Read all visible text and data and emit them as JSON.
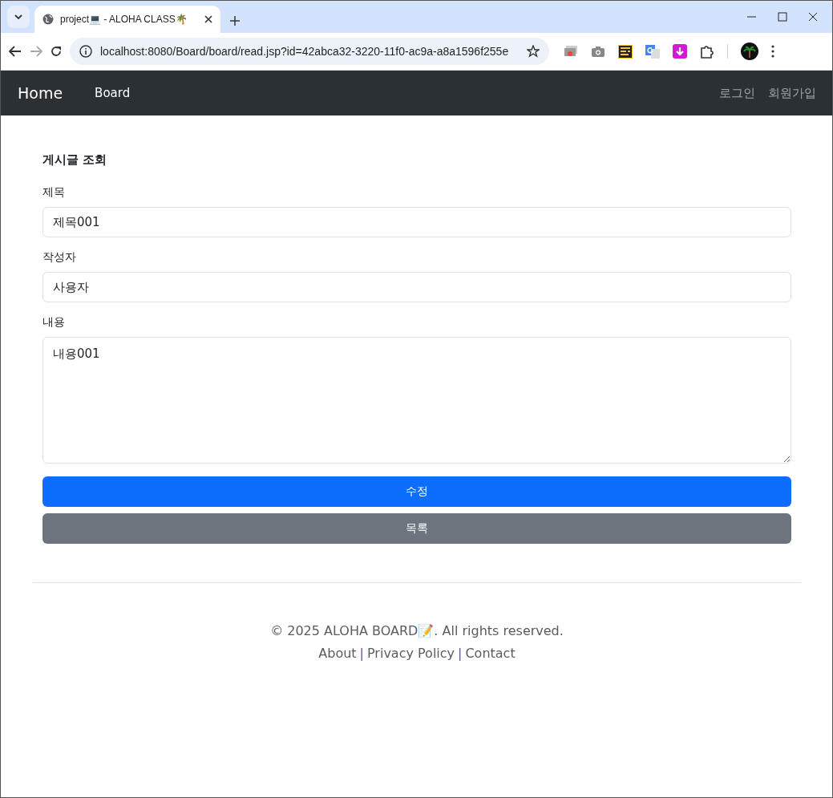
{
  "browser": {
    "tab_title": "project💻 - ALOHA CLASS🌴",
    "url": "localhost:8080/Board/board/read.jsp?id=42abca32-3220-11f0-ac9a-a8a1596f255e"
  },
  "navbar": {
    "brand": "Home",
    "left_links": [
      {
        "label": "Board",
        "selected": true
      }
    ],
    "right_links": [
      {
        "label": "로그인",
        "selected": false
      },
      {
        "label": "회원가입",
        "selected": false
      }
    ]
  },
  "form": {
    "heading": "게시글 조회",
    "fields": [
      {
        "kind": "input",
        "label": "제목",
        "value": "제목001"
      },
      {
        "kind": "input",
        "label": "작성자",
        "value": "사용자"
      },
      {
        "kind": "textarea",
        "label": "내용",
        "value": "내용001"
      }
    ],
    "buttons": [
      {
        "kind": "primary",
        "label": "수정"
      },
      {
        "kind": "secondary",
        "label": "목록"
      }
    ]
  },
  "footer": {
    "copyright": "© 2025 ALOHA BOARD📝. All rights reserved.",
    "links": [
      "About",
      "Privacy Policy",
      "Contact"
    ],
    "separator": "|"
  }
}
